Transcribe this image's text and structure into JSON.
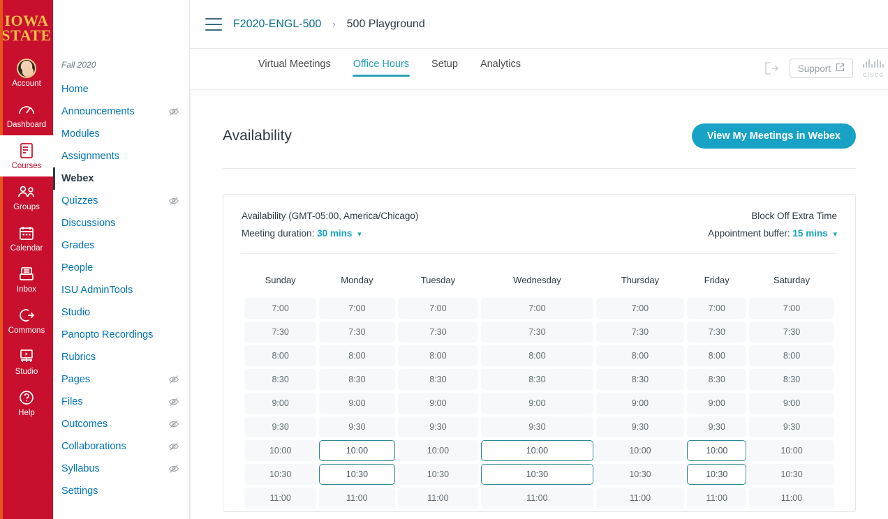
{
  "global_nav": {
    "logo": {
      "line1": "IOWA",
      "line2": "STATE"
    },
    "items": [
      {
        "label": "Account",
        "icon": "avatar-icon",
        "active": false
      },
      {
        "label": "Dashboard",
        "icon": "dashboard-icon",
        "active": false
      },
      {
        "label": "Courses",
        "icon": "courses-icon",
        "active": true
      },
      {
        "label": "Groups",
        "icon": "groups-icon",
        "active": false
      },
      {
        "label": "Calendar",
        "icon": "calendar-icon",
        "active": false
      },
      {
        "label": "Inbox",
        "icon": "inbox-icon",
        "active": false
      },
      {
        "label": "Commons",
        "icon": "commons-icon",
        "active": false
      },
      {
        "label": "Studio",
        "icon": "studio-icon",
        "active": false
      },
      {
        "label": "Help",
        "icon": "help-icon",
        "active": false
      }
    ]
  },
  "course_nav": {
    "term": "Fall 2020",
    "items": [
      {
        "label": "Home",
        "hidden_icon": false,
        "active": false
      },
      {
        "label": "Announcements",
        "hidden_icon": true,
        "active": false
      },
      {
        "label": "Modules",
        "hidden_icon": false,
        "active": false
      },
      {
        "label": "Assignments",
        "hidden_icon": false,
        "active": false
      },
      {
        "label": "Webex",
        "hidden_icon": false,
        "active": true
      },
      {
        "label": "Quizzes",
        "hidden_icon": true,
        "active": false
      },
      {
        "label": "Discussions",
        "hidden_icon": false,
        "active": false
      },
      {
        "label": "Grades",
        "hidden_icon": false,
        "active": false
      },
      {
        "label": "People",
        "hidden_icon": false,
        "active": false
      },
      {
        "label": "ISU AdminTools",
        "hidden_icon": false,
        "active": false
      },
      {
        "label": "Studio",
        "hidden_icon": false,
        "active": false
      },
      {
        "label": "Panopto Recordings",
        "hidden_icon": false,
        "active": false
      },
      {
        "label": "Rubrics",
        "hidden_icon": false,
        "active": false
      },
      {
        "label": "Pages",
        "hidden_icon": true,
        "active": false
      },
      {
        "label": "Files",
        "hidden_icon": true,
        "active": false
      },
      {
        "label": "Outcomes",
        "hidden_icon": true,
        "active": false
      },
      {
        "label": "Collaborations",
        "hidden_icon": true,
        "active": false
      },
      {
        "label": "Syllabus",
        "hidden_icon": true,
        "active": false
      },
      {
        "label": "Settings",
        "hidden_icon": false,
        "active": false
      }
    ]
  },
  "breadcrumb": {
    "menu_icon": "hamburger-icon",
    "course_code": "F2020-ENGL-500",
    "separator": "›",
    "page": "500 Playground"
  },
  "lti_header": {
    "tabs": [
      {
        "label": "Virtual Meetings",
        "active": false
      },
      {
        "label": "Office Hours",
        "active": true
      },
      {
        "label": "Setup",
        "active": false
      },
      {
        "label": "Analytics",
        "active": false
      }
    ],
    "logout_icon": "logout-icon",
    "support_label": "Support",
    "support_external_icon": "external-link-icon",
    "brand": "cisco"
  },
  "panel": {
    "title": "Availability",
    "webex_button": "View My Meetings in Webex"
  },
  "availability": {
    "timezone_label": "Availability (GMT-05:00, America/Chicago)",
    "meeting_duration_label": "Meeting duration:",
    "meeting_duration_value": "30 mins",
    "block_off_label": "Block Off Extra Time",
    "appointment_buffer_label": "Appointment buffer:",
    "appointment_buffer_value": "15 mins",
    "days": [
      "Sunday",
      "Monday",
      "Tuesday",
      "Wednesday",
      "Thursday",
      "Friday",
      "Saturday"
    ],
    "times": [
      "7:00",
      "7:30",
      "8:00",
      "8:30",
      "9:00",
      "9:30",
      "10:00",
      "10:30",
      "11:00"
    ],
    "selected": [
      {
        "day": "Monday",
        "time": "10:00"
      },
      {
        "day": "Wednesday",
        "time": "10:00"
      },
      {
        "day": "Friday",
        "time": "10:00"
      },
      {
        "day": "Monday",
        "time": "10:30"
      },
      {
        "day": "Wednesday",
        "time": "10:30"
      },
      {
        "day": "Friday",
        "time": "10:30"
      }
    ]
  },
  "colors": {
    "brand_red": "#C8102E",
    "brand_gold": "#F1BE48",
    "link_blue": "#0374B5",
    "accent_teal": "#17A2C6",
    "selected_border": "#2d8a96",
    "slot_bg": "#f7f8f9"
  }
}
